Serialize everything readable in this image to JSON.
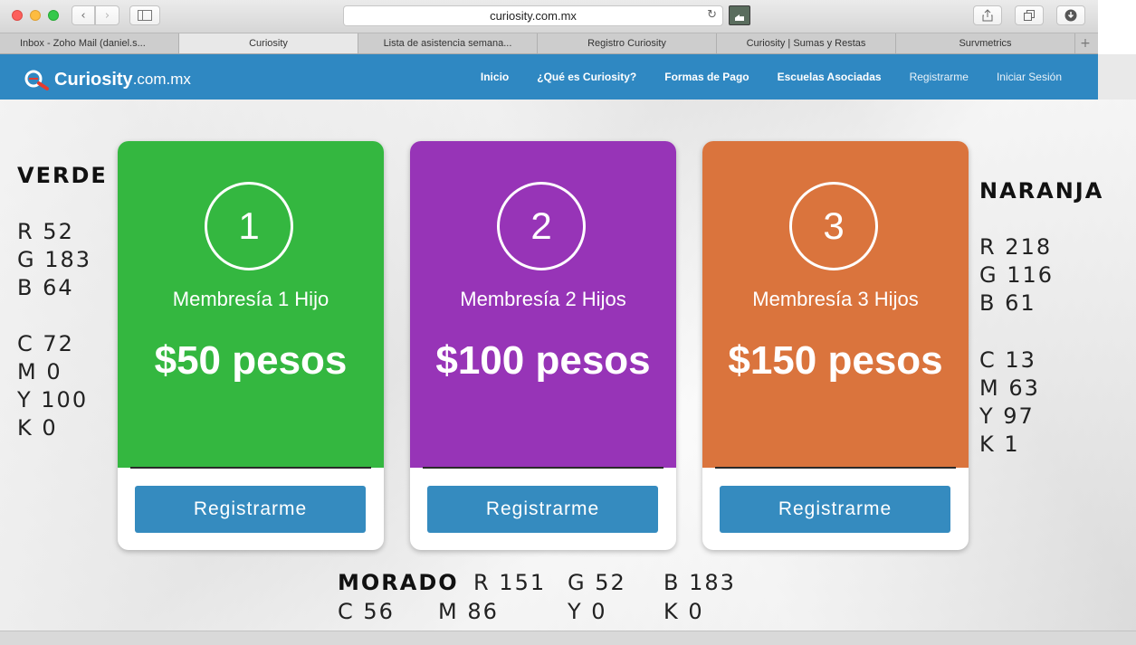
{
  "browser": {
    "url": "curiosity.com.mx",
    "tabs": [
      "Inbox - Zoho Mail (daniel.s...",
      "Curiosity",
      "Lista de asistencia semana...",
      "Registro Curiosity",
      "Curiosity | Sumas y Restas",
      "Survmetrics"
    ],
    "active_tab": 1
  },
  "site": {
    "logo_main": "Curiosity",
    "logo_domain": ".com.mx",
    "nav": [
      "Inicio",
      "¿Qué es Curiosity?",
      "Formas de Pago",
      "Escuelas Asociadas",
      "Registrarme",
      "Iniciar Sesión"
    ]
  },
  "plans": [
    {
      "number": "1",
      "name": "Membresía 1 Hijo",
      "price": "$50 pesos",
      "button": "Registrarme",
      "color": "#34b740"
    },
    {
      "number": "2",
      "name": "Membresía 2 Hijos",
      "price": "$100 pesos",
      "button": "Registrarme",
      "color": "#9734b7"
    },
    {
      "number": "3",
      "name": "Membresía 3 Hijos",
      "price": "$150 pesos",
      "button": "Registrarme",
      "color": "#da743d"
    }
  ],
  "swatches": {
    "verde": {
      "title": "VERDE",
      "rgb": [
        "R 52",
        "G 183",
        "B 64"
      ],
      "cmyk": [
        "C 72",
        "M 0",
        "Y 100",
        "K 0"
      ]
    },
    "naranja": {
      "title": "NARANJA",
      "rgb": [
        "R 218",
        "G 116",
        "B 61"
      ],
      "cmyk": [
        "C 13",
        "M 63",
        "Y 97",
        "K 1"
      ]
    },
    "morado": {
      "title": "MORADO",
      "rgb": [
        "R 151",
        "G 52",
        "B 183"
      ],
      "cmyk": [
        "C 56",
        "M 86",
        "Y 0",
        "K 0"
      ]
    }
  },
  "colors": {
    "header": "#2f88c2",
    "button": "#358bbf"
  }
}
